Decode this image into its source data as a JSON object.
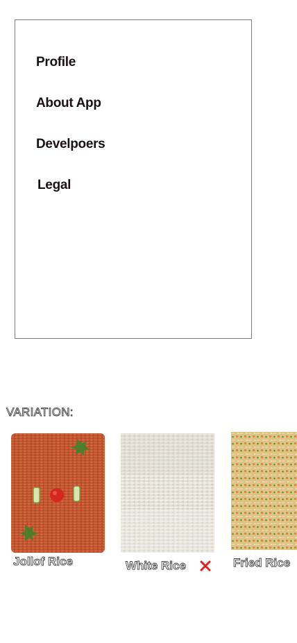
{
  "menu": {
    "items": [
      {
        "label": "Profile"
      },
      {
        "label": "About App"
      },
      {
        "label": "Develpoers"
      },
      {
        "label": "Legal"
      }
    ]
  },
  "variation": {
    "heading": "VARIATION:",
    "options": [
      {
        "name": "Jollof Rice",
        "image": "jollof-rice-photo"
      },
      {
        "name": "White Rice",
        "image": "white-rice-photo",
        "remove_icon": "close-icon",
        "remove_color": "#e02020"
      },
      {
        "name": "Fried Rice",
        "image": "fried-rice-photo"
      }
    ]
  }
}
